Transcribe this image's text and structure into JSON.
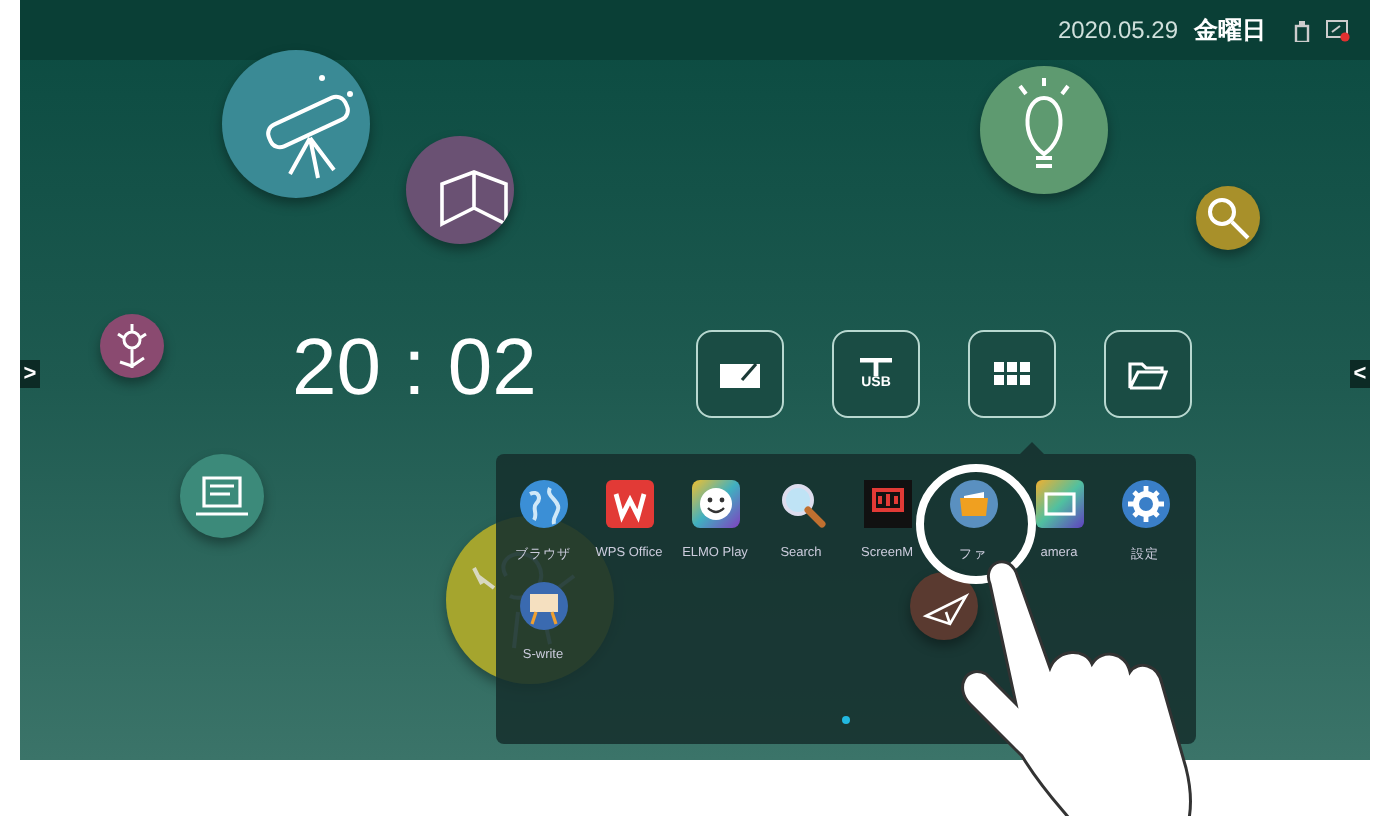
{
  "status_bar": {
    "date": "2020.05.29",
    "weekday": "金曜日"
  },
  "side_arrows": [
    {
      "kind": "left",
      "label": ">"
    },
    {
      "kind": "right",
      "label": "<"
    }
  ],
  "clock": {
    "time": "20 : 02"
  },
  "quick_buttons": [
    {
      "kind": "whiteboard"
    },
    {
      "kind": "usb",
      "label": "USB"
    },
    {
      "kind": "apps"
    },
    {
      "kind": "folder"
    }
  ],
  "bubbles": [
    {
      "kind": "telescope",
      "color": "#3a8a95"
    },
    {
      "kind": "book",
      "color": "#6a5173"
    },
    {
      "kind": "bulb",
      "color": "#5e9a70"
    },
    {
      "kind": "magnifier",
      "color": "#a8902a"
    },
    {
      "kind": "flower",
      "color": "#8a4a70"
    },
    {
      "kind": "computer",
      "color": "#3c8a7a"
    },
    {
      "kind": "robot",
      "color": "#a5a52e"
    },
    {
      "kind": "plane",
      "color": "#5a3a30"
    }
  ],
  "dock": {
    "apps": [
      {
        "kind": "globe",
        "label": "ブラウザ"
      },
      {
        "kind": "wps",
        "label": "WPS Office"
      },
      {
        "kind": "elmo",
        "label": "ELMO Play"
      },
      {
        "kind": "search",
        "label": "Search"
      },
      {
        "kind": "screen",
        "label": "ScreenM"
      },
      {
        "kind": "folder",
        "label": "ファ"
      },
      {
        "kind": "camera",
        "label": "amera"
      },
      {
        "kind": "gear",
        "label": "設定"
      },
      {
        "kind": "easel",
        "label": "S-write"
      }
    ],
    "pages": [
      {
        "selected": true
      }
    ]
  }
}
